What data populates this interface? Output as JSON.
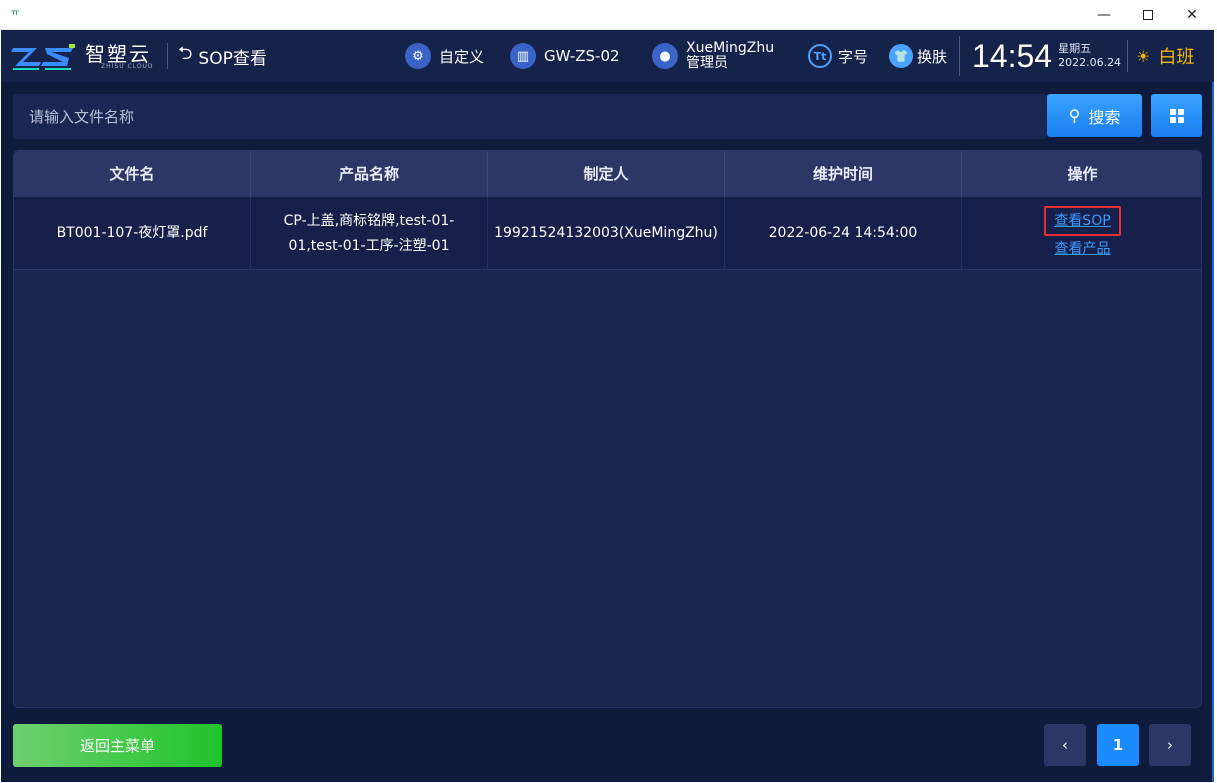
{
  "window": {
    "app_icon": "ㅠ",
    "minimize": "—",
    "close": "✕"
  },
  "header": {
    "brand_name": "智塑云",
    "brand_sub": "ZHISU CLOUD",
    "page_title": "SOP查看",
    "customize_label": "自定义",
    "station_label": "GW-ZS-02",
    "user_name": "XueMingZhu",
    "user_role": "管理员",
    "font_label": "字号",
    "skin_label": "换肤",
    "time": "14:54",
    "weekday": "星期五",
    "date": "2022.06.24",
    "shift_label": "白班"
  },
  "search": {
    "placeholder": "请输入文件名称",
    "button_label": "搜索"
  },
  "table": {
    "columns": [
      "文件名",
      "产品名称",
      "制定人",
      "维护时间",
      "操作"
    ],
    "rows": [
      {
        "file_name": "BT001-107-夜灯罩.pdf",
        "product_name": "CP-上盖,商标铭牌,test-01-01,test-01-工序-注塑-01",
        "creator": "19921524132003(XueMingZhu)",
        "maintain_time": "2022-06-24 14:54:00",
        "action_view_sop": "查看SOP",
        "action_view_product": "查看产品"
      }
    ]
  },
  "footer": {
    "back_label": "返回主菜单",
    "prev": "‹",
    "page": "1",
    "next": "›"
  },
  "colors": {
    "background": "#0f1b3d",
    "header": "#15224a",
    "accent": "#1a8cff",
    "link": "#3e9bff",
    "shift": "#f5b700",
    "back_button": "#1fc32a",
    "highlight": "#e53030"
  }
}
